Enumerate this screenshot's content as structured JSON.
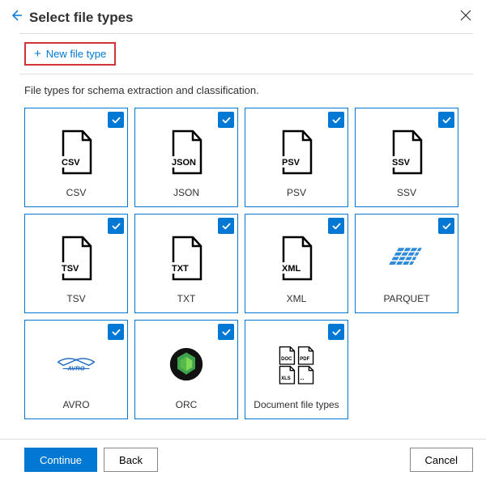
{
  "header": {
    "title": "Select file types"
  },
  "newFileType": {
    "label": "New file type"
  },
  "description": "File types for schema extraction and classification.",
  "tiles": [
    {
      "label": "CSV",
      "doclabel": "CSV",
      "icon": "doc"
    },
    {
      "label": "JSON",
      "doclabel": "JSON",
      "icon": "doc"
    },
    {
      "label": "PSV",
      "doclabel": "PSV",
      "icon": "doc"
    },
    {
      "label": "SSV",
      "doclabel": "SSV",
      "icon": "doc"
    },
    {
      "label": "TSV",
      "doclabel": "TSV",
      "icon": "doc"
    },
    {
      "label": "TXT",
      "doclabel": "TXT",
      "icon": "doc"
    },
    {
      "label": "XML",
      "doclabel": "XML",
      "icon": "doc"
    },
    {
      "label": "PARQUET",
      "icon": "parquet"
    },
    {
      "label": "AVRO",
      "icon": "avro"
    },
    {
      "label": "ORC",
      "icon": "orc"
    },
    {
      "label": "Document file types",
      "icon": "docgroup"
    }
  ],
  "footer": {
    "continue": "Continue",
    "back": "Back",
    "cancel": "Cancel"
  },
  "colors": {
    "primary": "#0078d4",
    "highlight": "#d13438"
  }
}
